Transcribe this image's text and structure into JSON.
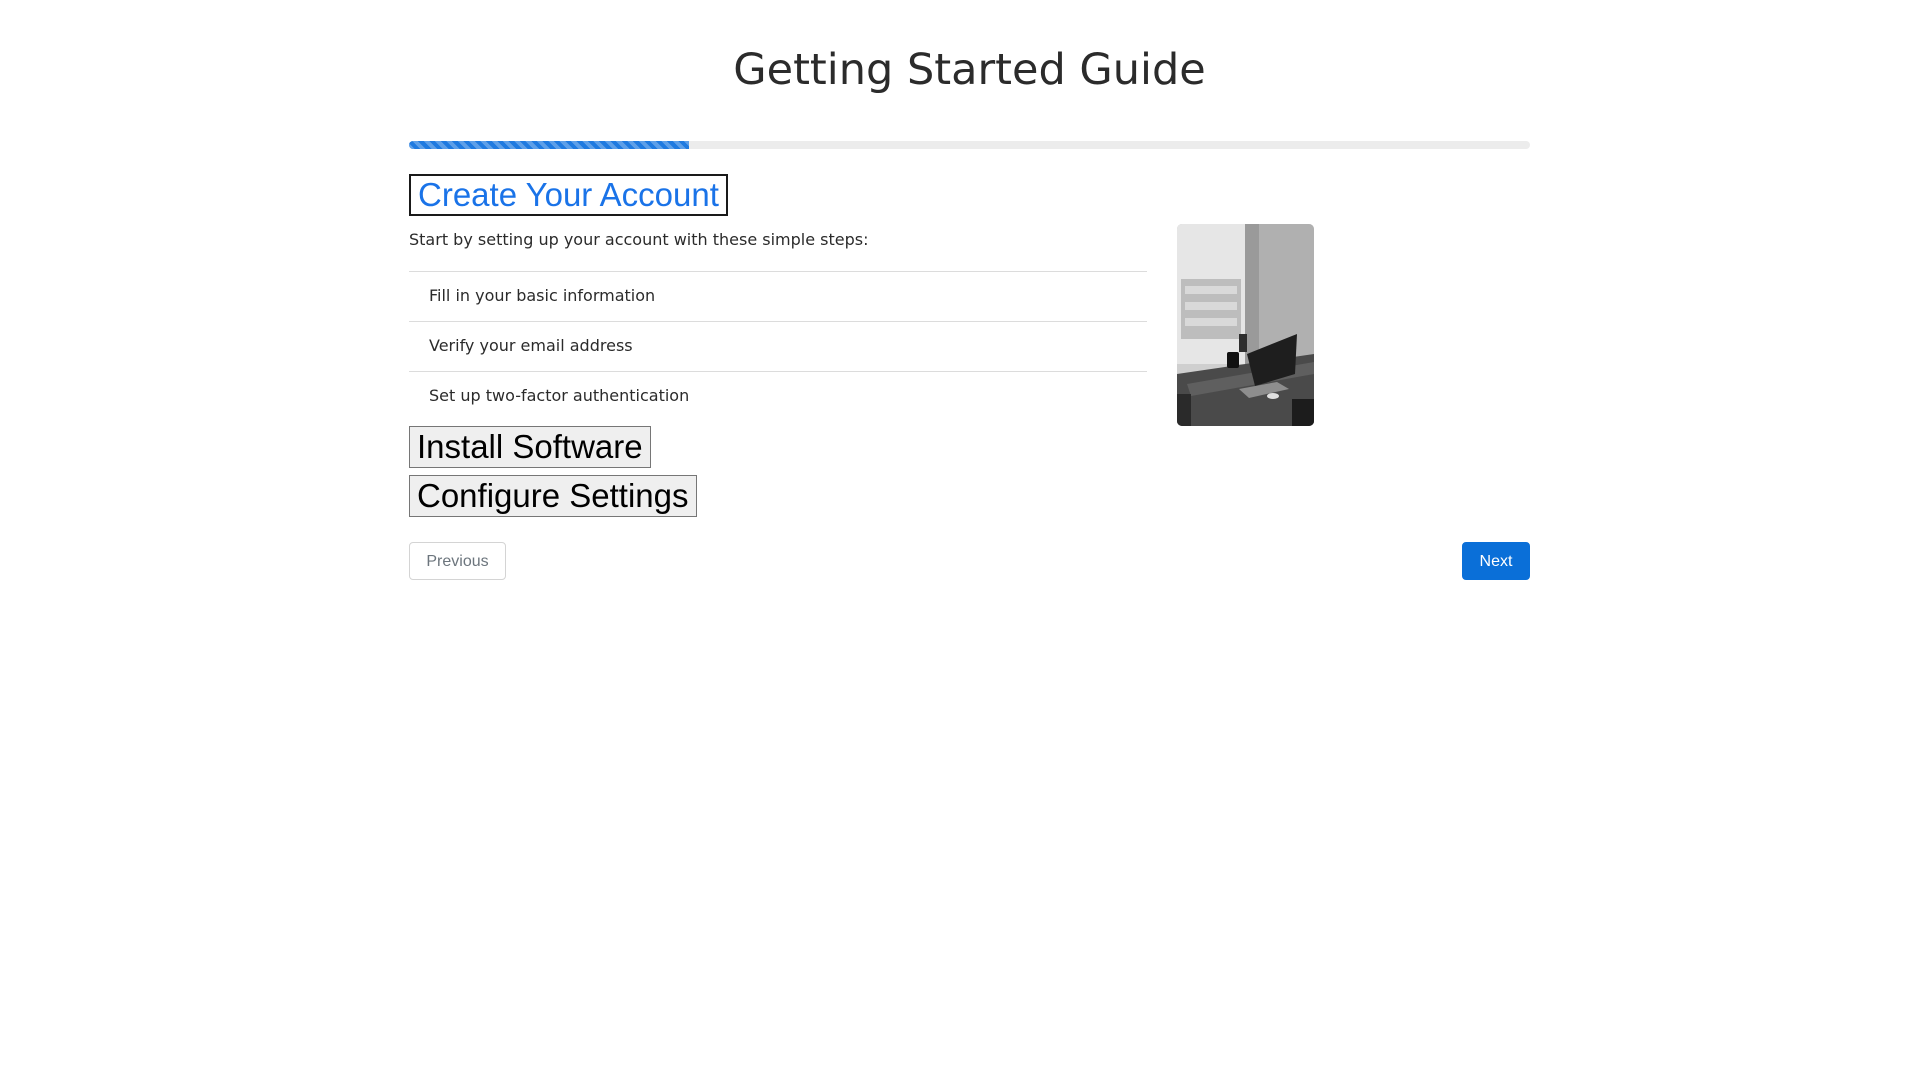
{
  "page": {
    "title": "Getting Started Guide"
  },
  "progress": {
    "value_percent": 25,
    "color": "#1f7ae0",
    "track_color": "#ececec"
  },
  "steps": [
    {
      "label": "Create Your Account",
      "state": "expanded",
      "description": "Start by setting up your account with these simple steps:",
      "items": [
        "Fill in your basic information",
        "Verify your email address",
        "Set up two-factor authentication"
      ],
      "image": "desk-workspace-photo"
    },
    {
      "label": "Install Software",
      "state": "collapsed"
    },
    {
      "label": "Configure Settings",
      "state": "collapsed"
    }
  ],
  "navigation": {
    "previous_label": "Previous",
    "next_label": "Next",
    "accent_color": "#0a6fd8"
  }
}
